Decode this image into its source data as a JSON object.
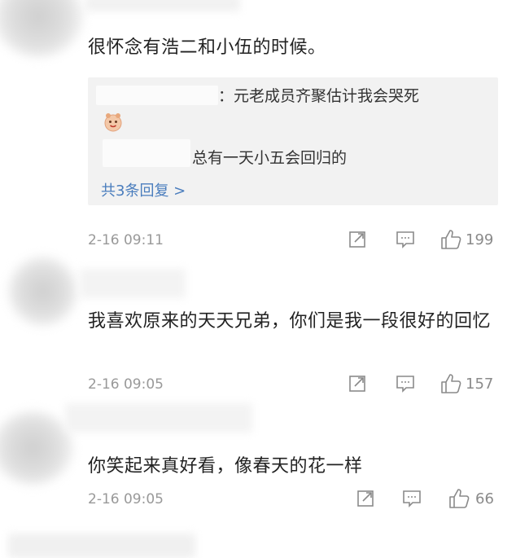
{
  "comments": [
    {
      "text": "很怀念有浩二和小伍的时候。",
      "replies": [
        {
          "prefix": "：",
          "text": "元老成员齐聚估计我会哭死"
        },
        {
          "text": "总有一天小五会回归的"
        }
      ],
      "more_replies": "共3条回复 >",
      "time": "2-16 09:11",
      "likes": "199"
    },
    {
      "text": "我喜欢原来的天天兄弟，你们是我一段很好的回忆",
      "time": "2-16 09:05",
      "likes": "157"
    },
    {
      "text": "你笑起来真好看，像春天的花一样",
      "time": "2-16 09:05",
      "likes": "66"
    }
  ],
  "icons": {
    "forward": "share-icon",
    "reply": "comment-icon",
    "like": "thumbs-up-icon"
  },
  "colors": {
    "link": "#4a7dbd",
    "meta": "#999999",
    "reply_bg": "#f2f2f2"
  }
}
